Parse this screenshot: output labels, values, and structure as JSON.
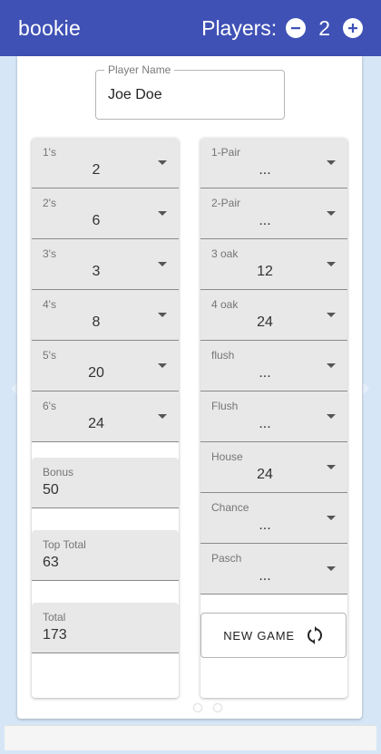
{
  "app": {
    "title": "bookie"
  },
  "players": {
    "label": "Players:",
    "count": "2",
    "decrement_glyph": "−",
    "increment_glyph": "+"
  },
  "player_name": {
    "label": "Player Name",
    "value": "Joe Doe"
  },
  "left_column": {
    "selects": [
      {
        "label": "1's",
        "value": "2"
      },
      {
        "label": "2's",
        "value": "6"
      },
      {
        "label": "3's",
        "value": "3"
      },
      {
        "label": "4's",
        "value": "8"
      },
      {
        "label": "5's",
        "value": "20"
      },
      {
        "label": "6's",
        "value": "24"
      }
    ],
    "bonus": {
      "label": "Bonus",
      "value": "50"
    },
    "top_total": {
      "label": "Top Total",
      "value": "63"
    },
    "total": {
      "label": "Total",
      "value": "173"
    }
  },
  "right_column": {
    "selects": [
      {
        "label": "1-Pair",
        "value": "..."
      },
      {
        "label": "2-Pair",
        "value": "..."
      },
      {
        "label": "3 oak",
        "value": "12"
      },
      {
        "label": "4 oak",
        "value": "24"
      },
      {
        "label": "flush",
        "value": "..."
      },
      {
        "label": "Flush",
        "value": "..."
      },
      {
        "label": "House",
        "value": "24"
      },
      {
        "label": "Chance",
        "value": "..."
      },
      {
        "label": "Pasch",
        "value": "..."
      }
    ],
    "new_game_label": "NEW GAME"
  },
  "icons": {
    "refresh": "refresh-icon",
    "minus": "minus-circle-icon",
    "plus": "plus-circle-icon",
    "dropdown": "arrow-drop-down-icon"
  },
  "colors": {
    "appbar": "#3f51b5",
    "background": "#d6e6f7",
    "field_fill": "#e8e8e8"
  },
  "carousel": {
    "pages": 2,
    "active": 2
  }
}
